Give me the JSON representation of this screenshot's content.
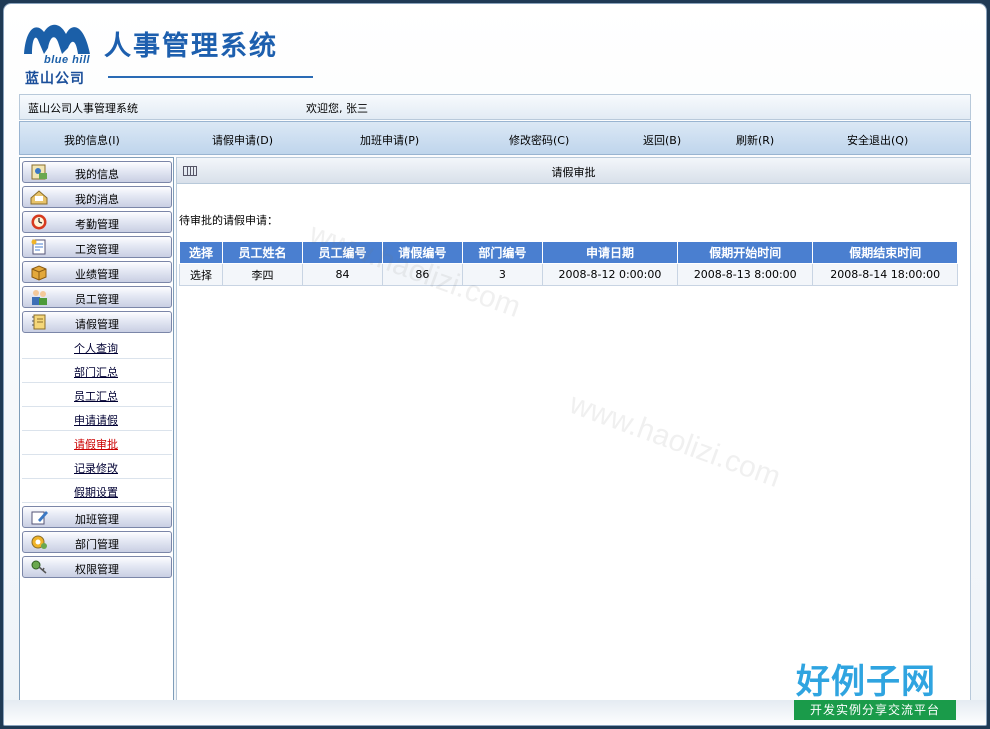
{
  "header": {
    "logo_en": "blue hill",
    "logo_cn": "蓝山公司",
    "system_title": "人事管理系统"
  },
  "status_bar": {
    "system_name": "蓝山公司人事管理系统",
    "welcome": "欢迎您, 张三"
  },
  "nav": {
    "items": [
      {
        "label": "我的信息(I)"
      },
      {
        "label": "请假申请(D)"
      },
      {
        "label": "加班申请(P)"
      },
      {
        "label": "修改密码(C)"
      },
      {
        "label": "返回(B)"
      },
      {
        "label": "刷新(R)"
      },
      {
        "label": "安全退出(Q)"
      }
    ]
  },
  "sidebar": {
    "menus": [
      {
        "label": "我的信息",
        "icon": "info-card-icon"
      },
      {
        "label": "我的消息",
        "icon": "message-icon"
      },
      {
        "label": "考勤管理",
        "icon": "clock-icon"
      },
      {
        "label": "工资管理",
        "icon": "salary-doc-icon"
      },
      {
        "label": "业绩管理",
        "icon": "box-icon"
      },
      {
        "label": "员工管理",
        "icon": "people-icon"
      },
      {
        "label": "请假管理",
        "icon": "notebook-icon"
      }
    ],
    "leave_submenu": [
      {
        "label": "个人查询"
      },
      {
        "label": "部门汇总"
      },
      {
        "label": "员工汇总"
      },
      {
        "label": "申请请假"
      },
      {
        "label": "请假审批",
        "active": true
      },
      {
        "label": "记录修改"
      },
      {
        "label": "假期设置"
      }
    ],
    "menus_after": [
      {
        "label": "加班管理",
        "icon": "pencil-doc-icon"
      },
      {
        "label": "部门管理",
        "icon": "gear-icon"
      },
      {
        "label": "权限管理",
        "icon": "key-icon"
      }
    ]
  },
  "main": {
    "title": "请假审批",
    "pending_label": "待审批的请假申请：",
    "table": {
      "headers": [
        "选择",
        "员工姓名",
        "员工编号",
        "请假编号",
        "部门编号",
        "申请日期",
        "假期开始时间",
        "假期结束时间"
      ],
      "rows": [
        [
          "选择",
          "李四",
          "84",
          "86",
          "3",
          "2008-8-12 0:00:00",
          "2008-8-13 8:00:00",
          "2008-8-14 18:00:00"
        ]
      ]
    }
  },
  "watermark": {
    "text": "www.haolizi.com",
    "brand_big": "好例子网",
    "brand_small": "开发实例分享交流平台"
  },
  "colors": {
    "title_blue": "#1d5fae",
    "table_header": "#4a7fd0",
    "active_link": "#cc0000"
  }
}
